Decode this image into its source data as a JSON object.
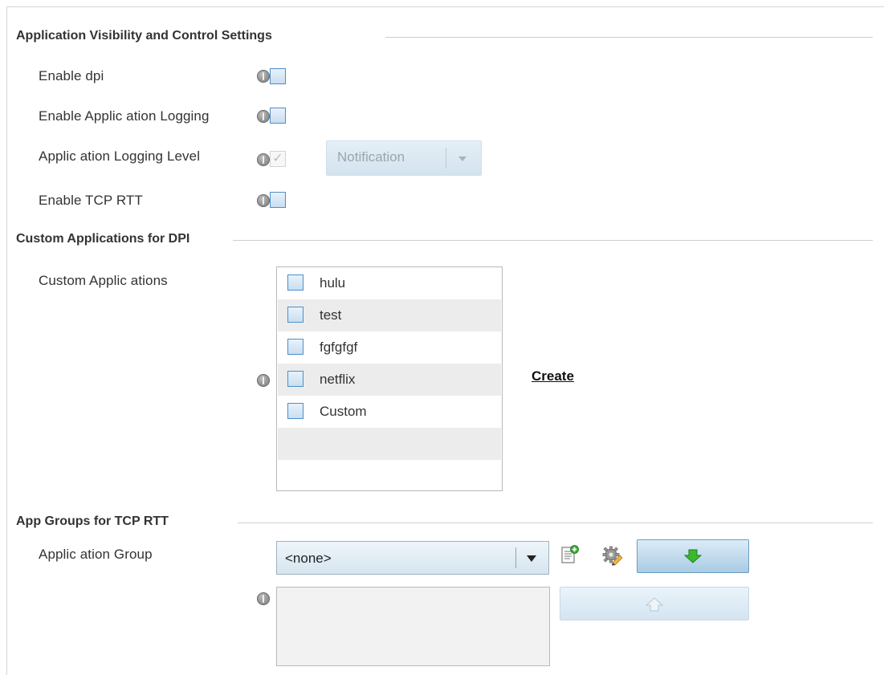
{
  "sections": {
    "avc": {
      "title": "Application Visibility and Control Settings"
    },
    "custom": {
      "title": "Custom Applications for DPI"
    },
    "appgroups": {
      "title": "App Groups for TCP RTT"
    }
  },
  "avc": {
    "enable_dpi_label": "Enable dpi",
    "enable_app_logging_label": "Enable Applic ation Logging",
    "app_logging_level_label": "Applic ation Logging Level",
    "app_logging_level_value": "Notification",
    "enable_tcp_rtt_label": "Enable TCP RTT",
    "checkmark": "✓"
  },
  "custom": {
    "label": "Custom Applic ations",
    "items": [
      {
        "label": "hulu"
      },
      {
        "label": "test"
      },
      {
        "label": "fgfgfgf"
      },
      {
        "label": "netflix"
      },
      {
        "label": "Custom"
      }
    ],
    "create_link": "Create"
  },
  "appgroups": {
    "label": "Applic ation Group",
    "select_value": "<none>"
  },
  "colors": {
    "checkbox_border": "#4d8fc9",
    "button_gradient_bottom": "#a9cbe4",
    "arrow_green": "#3cb82f"
  },
  "icons": {
    "info": "info-icon",
    "add_item": "add-item-icon",
    "settings": "gear-edit-icon",
    "move_down": "down-arrow-icon",
    "move_up": "up-arrow-icon"
  }
}
